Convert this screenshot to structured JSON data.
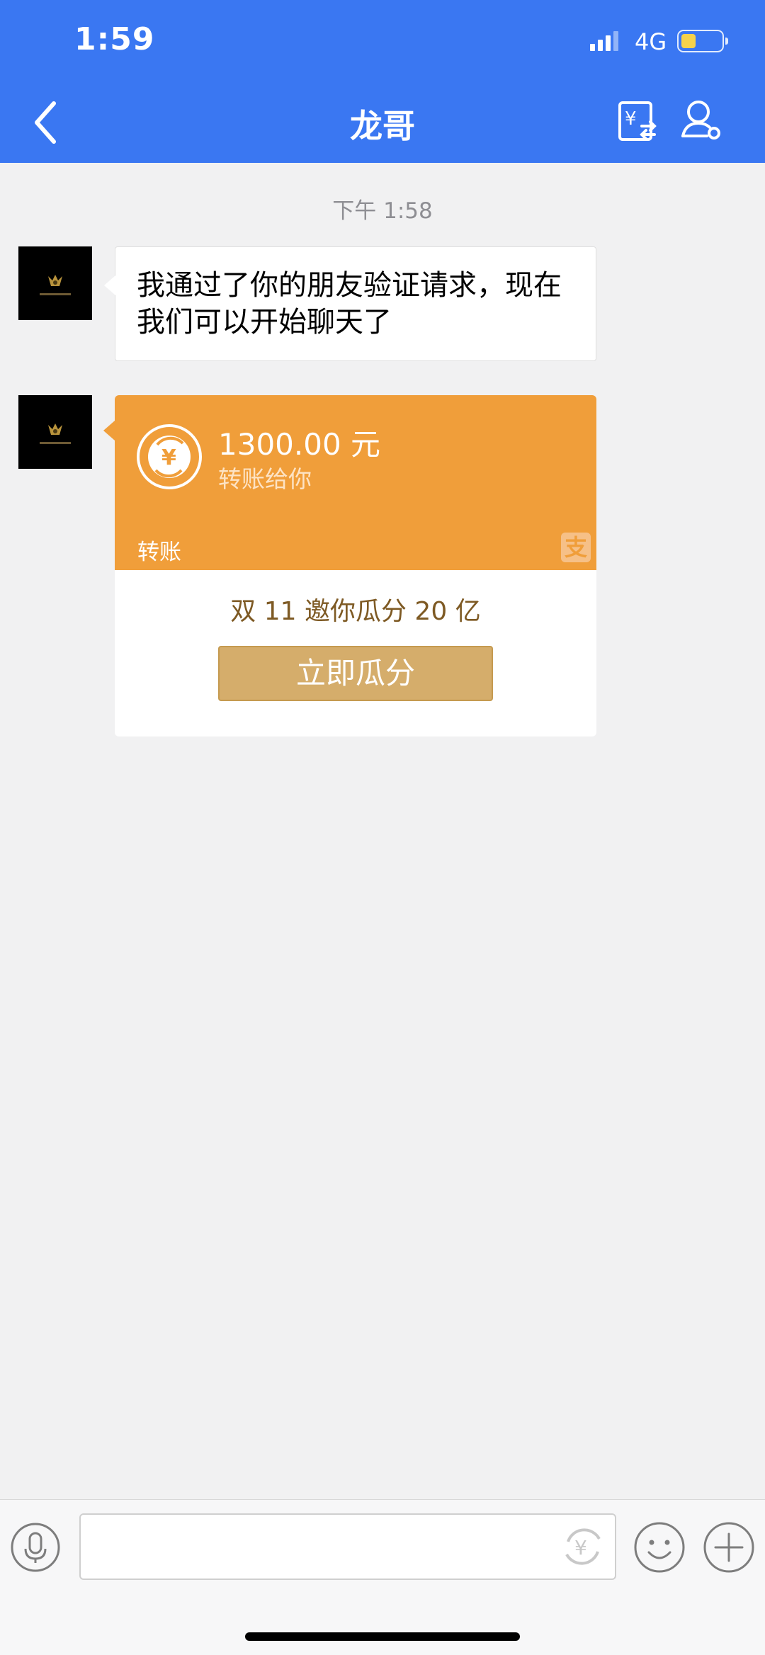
{
  "status_bar": {
    "time": "1:59",
    "network": "4G"
  },
  "header": {
    "title": "龙哥",
    "icons": [
      "back-icon",
      "transfer-icon",
      "profile-icon"
    ]
  },
  "chat": {
    "timestamp": "下午 1:58",
    "messages": [
      {
        "type": "text",
        "text": "我通过了你的朋友验证请求，现在我们可以开始聊天了"
      },
      {
        "type": "transfer",
        "amount": "1300.00 元",
        "subtitle": "转账给你",
        "label": "转账",
        "promo": "双 11 邀你瓜分 20 亿",
        "button": "立即瓜分"
      }
    ]
  },
  "input_bar": {
    "text_value": "",
    "icons": [
      "mic-icon",
      "yen-icon",
      "emoji-icon",
      "plus-icon"
    ]
  },
  "colors": {
    "header": "#3a77f2",
    "transfer_orange": "#f09e3a",
    "button_gold": "#d5ad6b"
  }
}
